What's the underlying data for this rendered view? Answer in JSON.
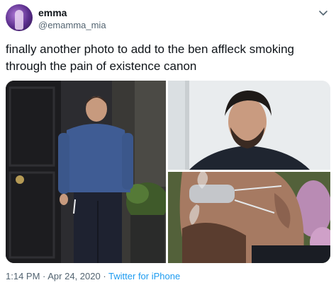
{
  "user": {
    "display_name": "emma",
    "handle": "@emamma_mia"
  },
  "tweet": {
    "text": "finally another photo to add to the ben affleck smoking through the pain of existence canon"
  },
  "media": {
    "photos": [
      {
        "description_name": "man-smoking-outside-door-photo"
      },
      {
        "description_name": "man-portrait-photo"
      },
      {
        "description_name": "man-smoking-through-mask-photo"
      }
    ]
  },
  "footer": {
    "time": "1:14 PM",
    "separator": " · ",
    "date": "Apr 24, 2020",
    "separator2": " · ",
    "source": "Twitter for iPhone"
  },
  "colors": {
    "text": "#0f1419",
    "secondary": "#536471",
    "link": "#1d9bf0"
  },
  "icons": [
    "chevron-down-icon"
  ]
}
